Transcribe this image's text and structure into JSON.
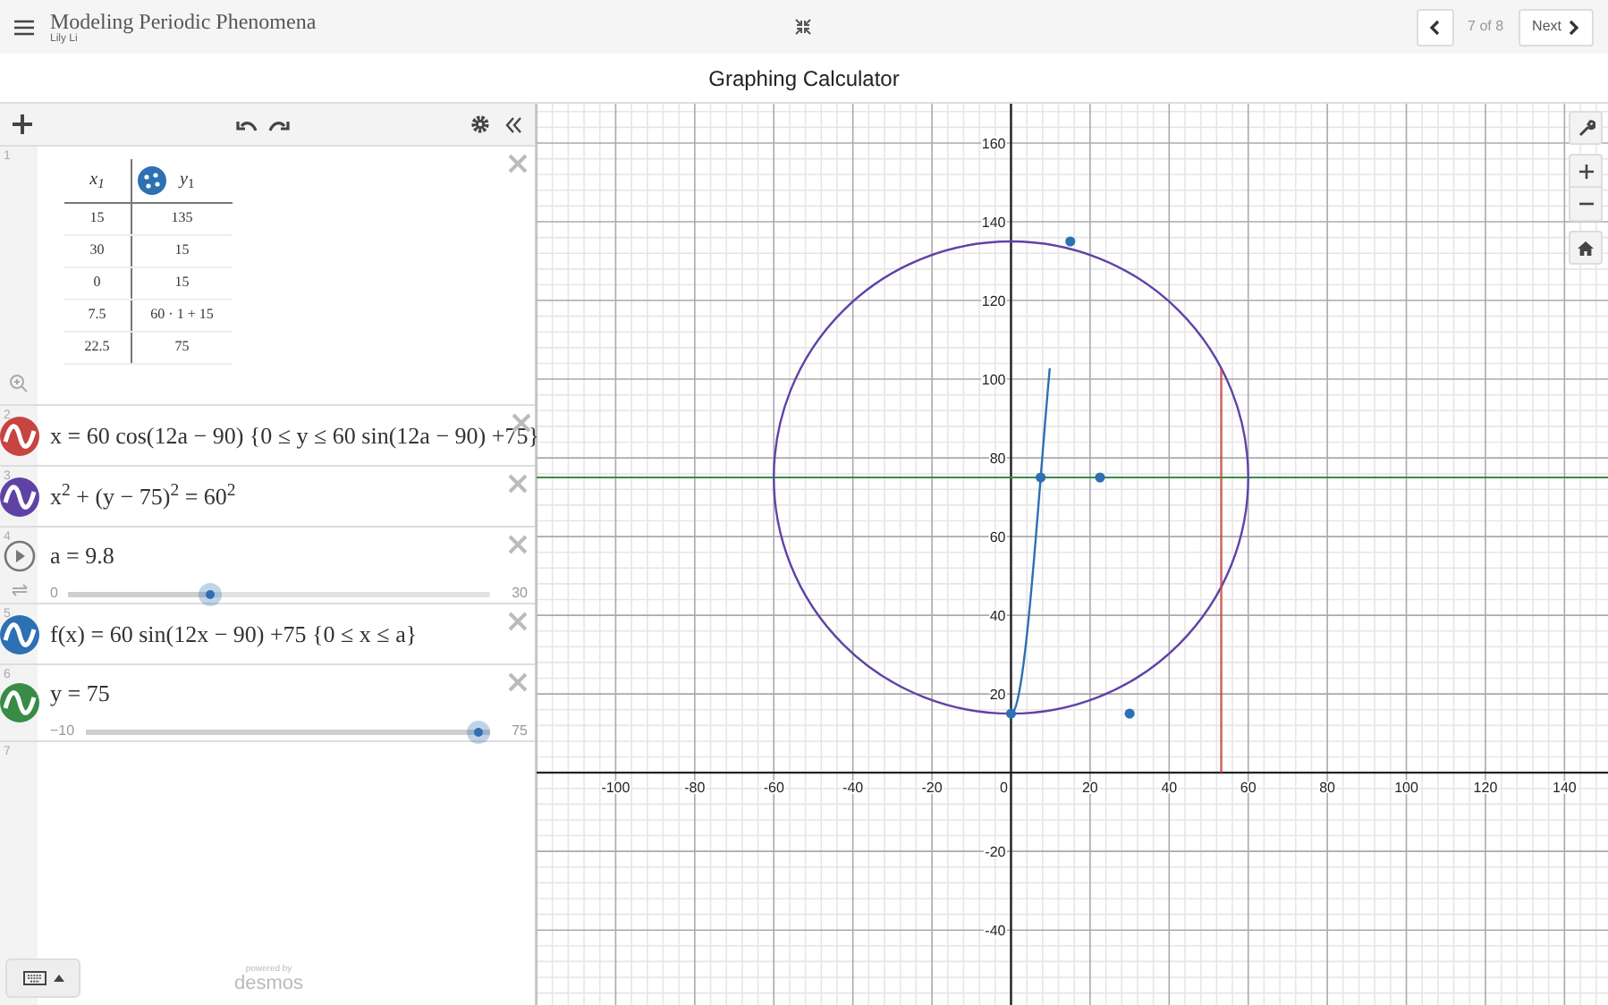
{
  "header": {
    "title": "Modeling Periodic Phenomena",
    "author": "Lily Li",
    "page_indicator": "7 of 8",
    "next_label": "Next"
  },
  "heading": "Graphing Calculator",
  "expressions": [
    {
      "kind": "table",
      "number": "1",
      "columns": [
        "*x*$_{1}$",
        "*y*$_{1}$"
      ],
      "color": "#2d70b3",
      "rows": [
        [
          "15",
          "135"
        ],
        [
          "30",
          "15"
        ],
        [
          "0",
          "15"
        ],
        [
          "7.5",
          "60 · 1 + 15"
        ],
        [
          "22.5",
          "75"
        ]
      ]
    },
    {
      "kind": "expression",
      "number": "2",
      "color": "#c74440",
      "latex": "x = 60 cos(12a − 90) {0 ≤ y ≤ 60 sin(12a − 90) +75}"
    },
    {
      "kind": "expression",
      "number": "3",
      "color": "#6042a6",
      "latex": "x$^{2}$ + (y − 75)$^{2}$ = 60$^{2}$"
    },
    {
      "kind": "slider",
      "number": "4",
      "latex": "a = 9.8",
      "min": "0",
      "max": "30",
      "level": 0.327,
      "playing": false
    },
    {
      "kind": "expression",
      "number": "5",
      "color": "#2d70b3",
      "latex": "f(x) = 60 sin(12x − 90) +75 {0 ≤ x ≤ a}"
    },
    {
      "kind": "slider_expression",
      "number": "6",
      "color": "#388c46",
      "latex": "y = 75",
      "min": "−10",
      "max": "75",
      "level": 1.0
    },
    {
      "kind": "empty",
      "number": "7"
    }
  ],
  "footer": {
    "powered_by": "powered by",
    "brand": "desmos"
  },
  "graph": {
    "chart_data": {
      "type": "scatter",
      "grid": true,
      "xlim": [
        -120,
        151
      ],
      "ylim": [
        -59.5,
        170
      ],
      "ref_lines": [
        {
          "axis": "y",
          "value": 75,
          "color": "#388c46"
        }
      ],
      "xticks": [
        -100,
        -80,
        -60,
        -40,
        -20,
        0,
        20,
        40,
        60,
        80,
        100,
        120,
        140
      ],
      "yticks": [
        -40,
        -20,
        20,
        40,
        60,
        80,
        100,
        120,
        140,
        160
      ],
      "x": [
        15,
        30,
        0,
        7.5,
        22.5
      ],
      "series": [
        {
          "color": "#2d70b3",
          "values": [
            135,
            15,
            15,
            75,
            75
          ]
        }
      ]
    }
  }
}
